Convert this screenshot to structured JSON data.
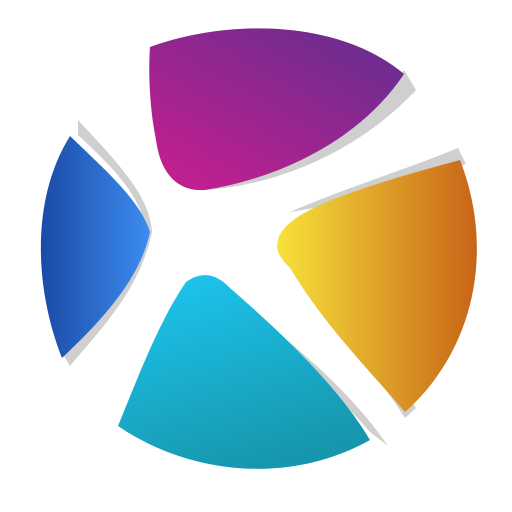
{
  "logo": {
    "name": "four-petal-circle-logo",
    "colors": {
      "purple": [
        "#6f2c8f",
        "#c01f8f"
      ],
      "blue": [
        "#1b4aa7",
        "#3c8df0"
      ],
      "orange": [
        "#f7e23a",
        "#c86418"
      ],
      "cyan": [
        "#1ec6f0",
        "#1697ad"
      ],
      "shadow": "#cfcfcf",
      "background": "#ffffff"
    }
  }
}
